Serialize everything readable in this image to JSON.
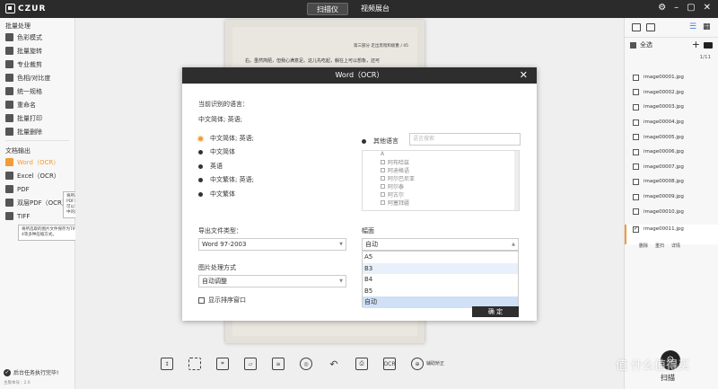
{
  "app": {
    "logo": "CZUR"
  },
  "top_tabs": [
    {
      "label": "扫描仪",
      "active": true
    },
    {
      "label": "视频展台",
      "active": false
    }
  ],
  "sidebar": {
    "section1": "批量处理",
    "items1": [
      "色彩模式",
      "批量旋转",
      "专业裁剪",
      "色相/对比度",
      "统一规格",
      "重命名",
      "批量打印",
      "批量删除"
    ],
    "section2": "文档输出",
    "items2": [
      "Word（OCR）",
      "Excel（OCR）",
      "PDF",
      "双层PDF（OCR）",
      "TIFF"
    ],
    "tooltip_pdf": "将所选取的图片文件保存为双层PDF（全称Searchable PDF），每一个页面都是由两层即图像层与文字层所组成，既可以读取图像中的图形与文字，又能运用文字层，直接对其中的内容进行检索。",
    "tooltip_tiff": "将所选取的图片文件保存为TIFF文件，支持彩色、灰度图像，有LZW、JPEG和Group 4等多种压缩方式。",
    "bottom_check": "后台任务执行完毕!",
    "version": "主版本号：2.0"
  },
  "dialog": {
    "title": "Word（OCR）",
    "current_lang_label": "当前识别的语言：",
    "current_lang_value": "中文简体; 英语;",
    "radio_options": [
      "中文简体; 英语;",
      "中文简体",
      "英语",
      "中文繁体; 英语;",
      "中文繁体"
    ],
    "other_lang_label": "其他语言",
    "search_placeholder": "语言搜索",
    "lang_header": "A",
    "lang_list": [
      "阿布哈兹",
      "阿迪格语",
      "阿尔巴尼亚",
      "阿尔泰",
      "阿古尔",
      "阿塞拜疆"
    ],
    "export_type_label": "导出文件类型：",
    "export_type_value": "Word 97-2003",
    "page_size_label": "幅面",
    "page_size_value": "自动",
    "page_size_options": [
      "A5",
      "B3",
      "B4",
      "B5",
      "自动"
    ],
    "image_proc_label": "图片处理方式",
    "image_proc_value": "自动调整",
    "show_order_label": "显示排序窗口",
    "ok_button": "确 定"
  },
  "toolbar": {
    "ocr_label": "OCR",
    "correct_label": "辅助矫正"
  },
  "right_panel": {
    "select_all": "全选",
    "page_indicator": "1/11",
    "files": [
      "image00001.jpg",
      "image00002.jpg",
      "image00003.jpg",
      "image00004.jpg",
      "image00005.jpg",
      "image00006.jpg",
      "image00007.jpg",
      "image00008.jpg",
      "image00009.jpg",
      "image00010.jpg",
      "image00011.jpg"
    ],
    "active_actions": [
      "删除",
      "重扫",
      "详情"
    ],
    "scan_label": "扫描"
  },
  "document": {
    "header": "第三部分 走出黑暗和疲惫 / 45",
    "line1": "右。虽然简陋，但我心满意足。这儿先吃起，躺在上可以想象，还可"
  },
  "watermark": "值 什么值得买",
  "colors": {
    "accent": "#f29b38",
    "dark": "#2e2e2e"
  }
}
